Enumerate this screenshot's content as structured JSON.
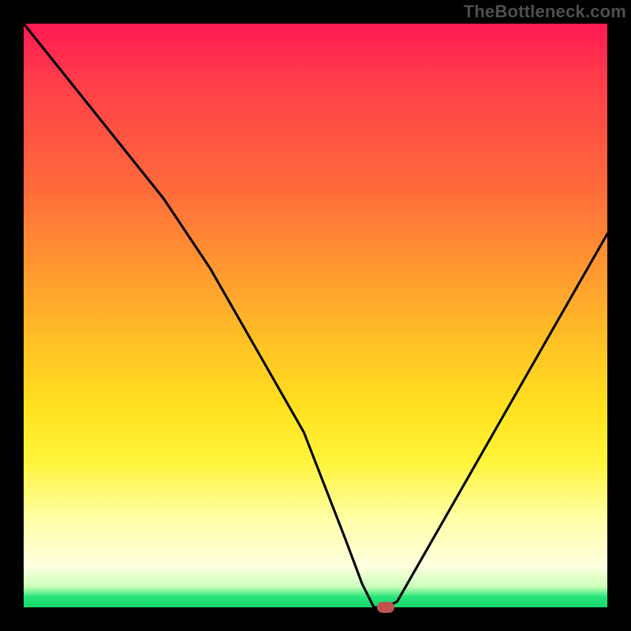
{
  "watermark": "TheBottleneck.com",
  "chart_data": {
    "type": "line",
    "title": "",
    "xlabel": "",
    "ylabel": "",
    "xlim": [
      0,
      100
    ],
    "ylim": [
      0,
      100
    ],
    "grid": false,
    "legend": false,
    "series": [
      {
        "name": "bottleneck-curve",
        "x": [
          0,
          8,
          16,
          24,
          32,
          40,
          48,
          55,
          58,
          60,
          62,
          64,
          68,
          76,
          84,
          92,
          100
        ],
        "y": [
          100,
          90,
          80,
          70,
          58,
          44,
          30,
          12,
          4,
          0,
          0,
          1,
          8,
          22,
          36,
          50,
          64
        ]
      }
    ],
    "marker": {
      "x": 62,
      "y": 0,
      "color": "#c1534d"
    },
    "background_gradient": {
      "stops": [
        {
          "pos": 0.0,
          "color": "#ff1a52"
        },
        {
          "pos": 0.28,
          "color": "#ff6a3b"
        },
        {
          "pos": 0.55,
          "color": "#ffc225"
        },
        {
          "pos": 0.75,
          "color": "#fff43a"
        },
        {
          "pos": 0.93,
          "color": "#ffffe0"
        },
        {
          "pos": 1.0,
          "color": "#17d66c"
        }
      ]
    }
  }
}
